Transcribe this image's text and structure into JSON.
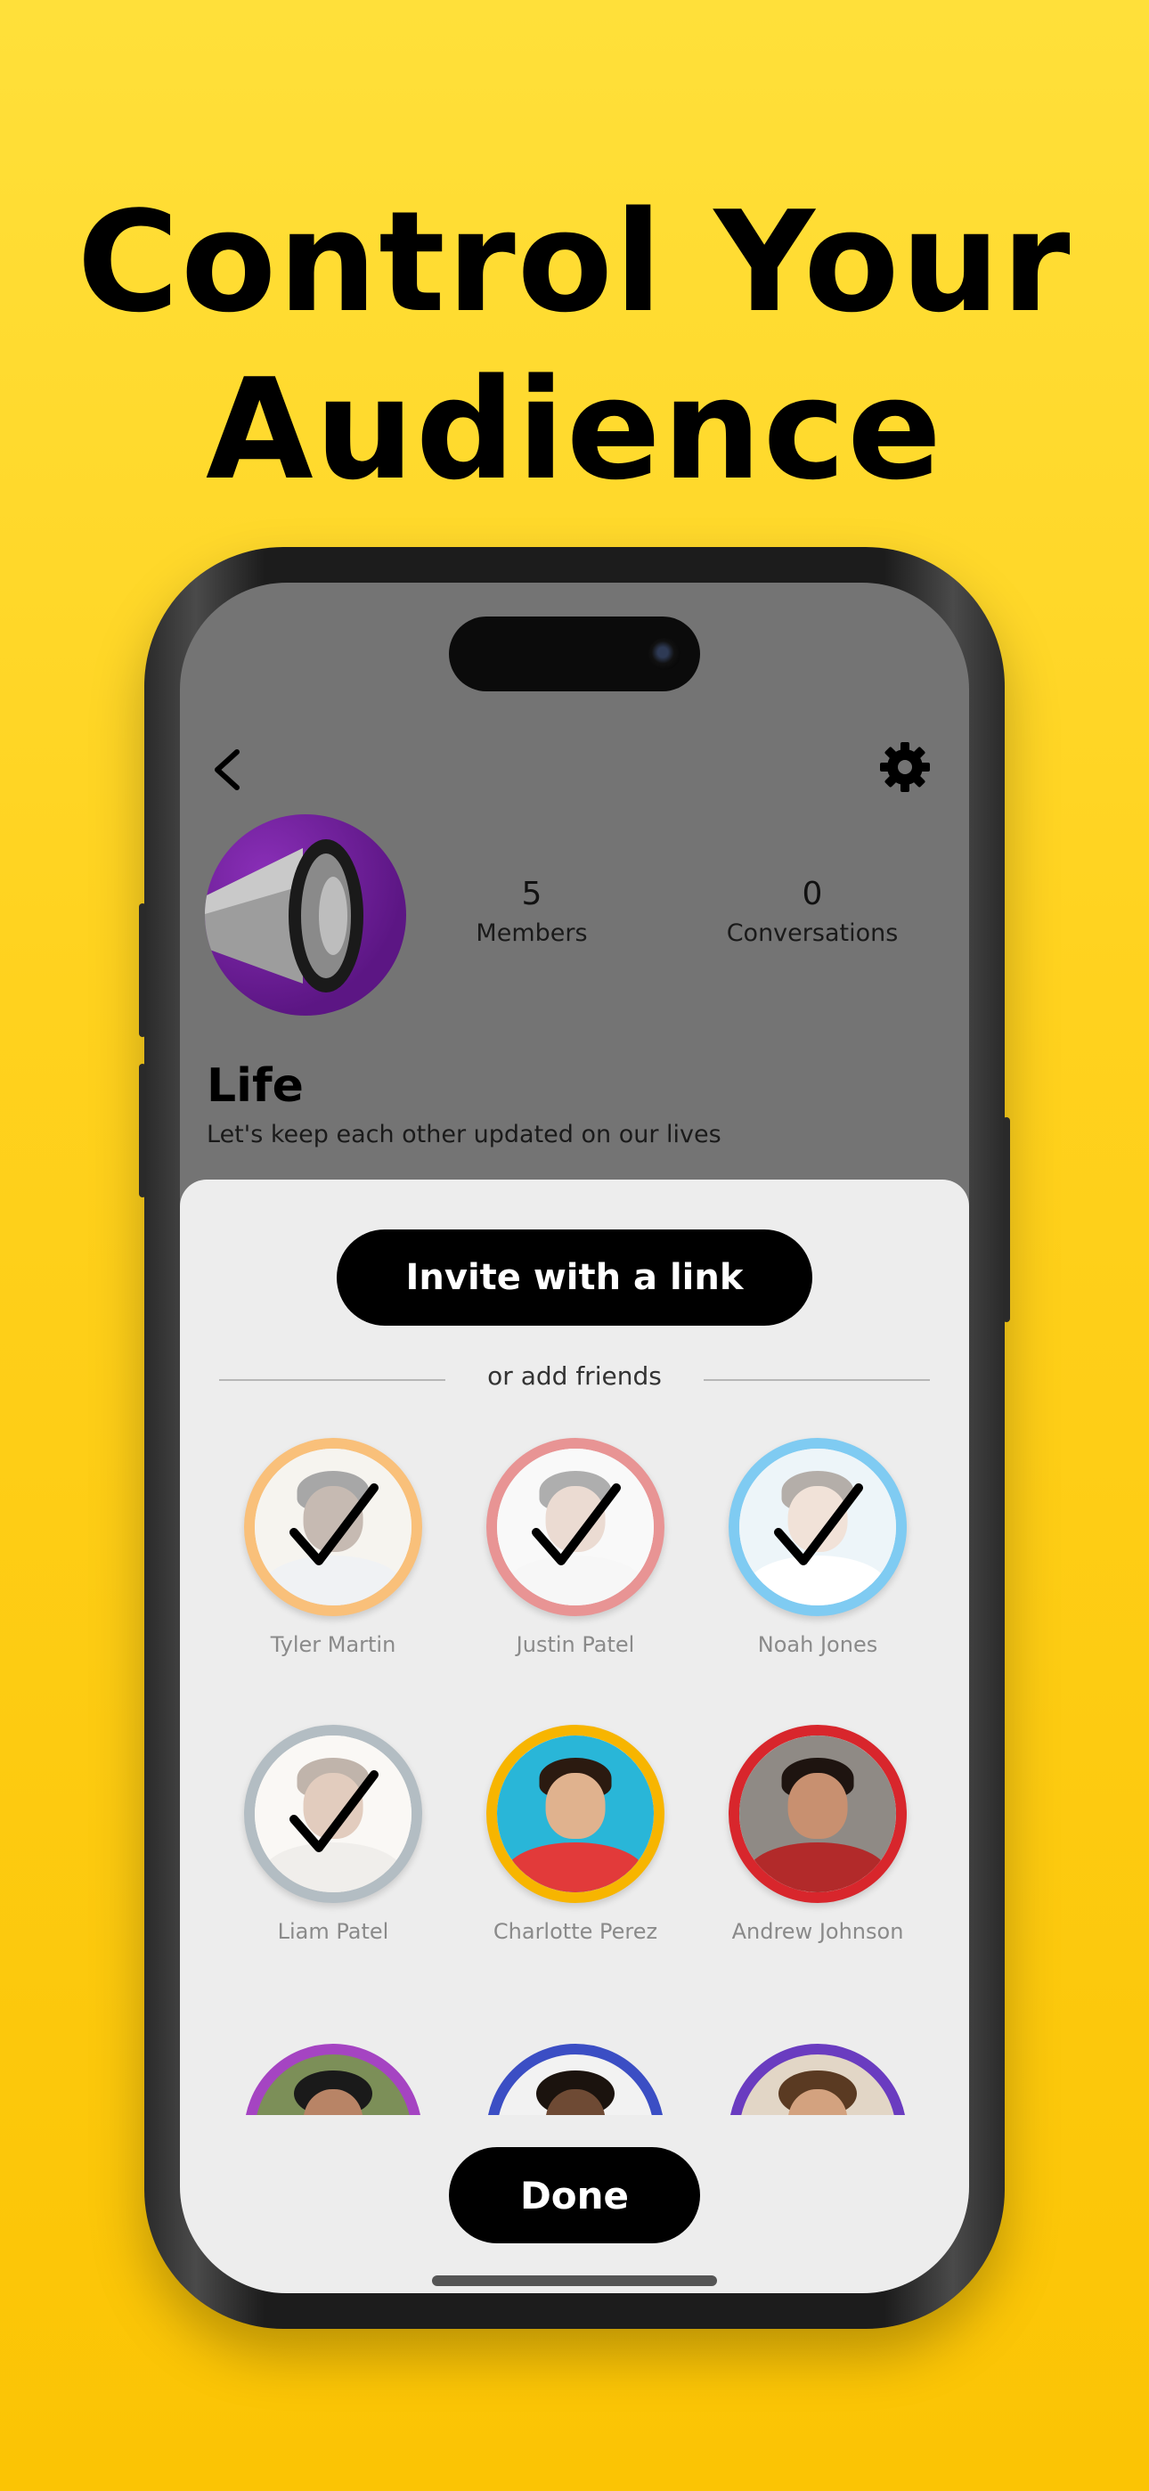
{
  "headline": {
    "line1": "Control Your",
    "line2": "Audience"
  },
  "group": {
    "name": "Life",
    "description": "Let's keep each other updated on our lives",
    "avatar_icon": "megaphone-icon",
    "stats": [
      {
        "value": "5",
        "label": "Members"
      },
      {
        "value": "0",
        "label": "Conversations"
      }
    ]
  },
  "toolbar": {
    "back_icon": "chevron-left-icon",
    "settings_icon": "gear-icon"
  },
  "sheet": {
    "invite_label": "Invite with a link",
    "divider_text": "or add friends",
    "done_label": "Done"
  },
  "friends": [
    {
      "name": "Tyler Martin",
      "ring_color": "#F9C07A",
      "selected": true
    },
    {
      "name": "Justin Patel",
      "ring_color": "#E89494",
      "selected": true
    },
    {
      "name": "Noah Jones",
      "ring_color": "#7FCBF2",
      "selected": true
    },
    {
      "name": "Liam Patel",
      "ring_color": "#B3BDC3",
      "selected": true
    },
    {
      "name": "Charlotte Perez",
      "ring_color": "#F7B500",
      "selected": false
    },
    {
      "name": "Andrew Johnson",
      "ring_color": "#D8262C",
      "selected": false
    }
  ],
  "partial_friends": [
    {
      "ring_color": "#A544C2"
    },
    {
      "ring_color": "#3B4EC4"
    },
    {
      "ring_color": "#6A3CC0"
    }
  ],
  "colors": {
    "background_top": "#FFE03A",
    "background_bottom": "#FBC404",
    "screen_dim": "#747474",
    "sheet": "#EDEDED",
    "button": "#000000"
  }
}
